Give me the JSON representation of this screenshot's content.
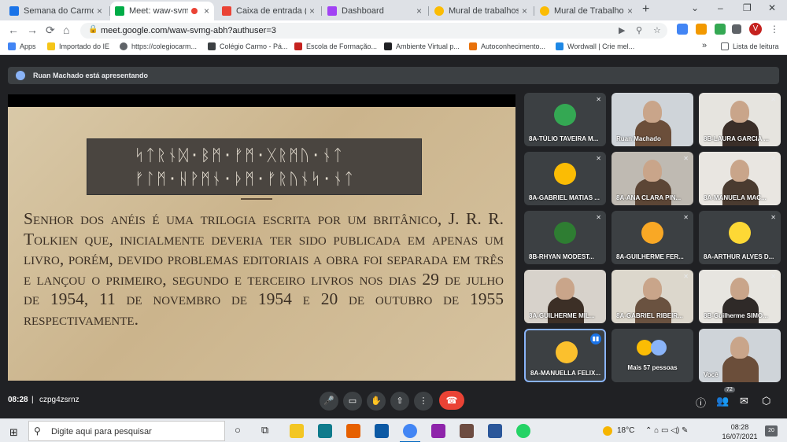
{
  "browser": {
    "tabs": [
      {
        "title": "Semana do Carmo - 8°",
        "favicon_color": "#1a73e8"
      },
      {
        "title": "Meet: waw-svmg-",
        "favicon_color": "#00ac47",
        "active": true,
        "recording": true
      },
      {
        "title": "Caixa de entrada (41)",
        "favicon_color": "#ea4335"
      },
      {
        "title": "Dashboard",
        "favicon_color": "#a142f4"
      },
      {
        "title": "Mural de trabalhos do",
        "favicon_color": "#fbbc04"
      },
      {
        "title": "Mural de Trabalhos do",
        "favicon_color": "#fbbc04"
      }
    ],
    "close_glyph": "×",
    "newtab_glyph": "+",
    "window_controls": {
      "profile": "⌄",
      "minimize": "–",
      "maximize": "❐",
      "close": "✕"
    },
    "nav": {
      "back": "←",
      "forward": "→",
      "reload": "⟳",
      "home": "⌂"
    },
    "url": "meet.google.com/waw-svmg-abh?authuser=3",
    "omnibox_icons": {
      "camera": "▶",
      "zoom": "⚲",
      "star": "☆"
    },
    "profile_initial": "V",
    "menu_glyph": "⋮",
    "extension_colors": [
      "#4285f4",
      "#f29900",
      "#34a853",
      "#5f6368",
      "#5f6368"
    ],
    "bookmarks": [
      {
        "label": "Apps",
        "color": "#4285f4"
      },
      {
        "label": "Importado do IE",
        "color": "#f5c518"
      },
      {
        "label": "https://colegiocarm...",
        "color": "#5f6368"
      },
      {
        "label": "Colégio Carmo - Pá...",
        "color": "#3c4043"
      },
      {
        "label": "Escola de Formação...",
        "color": "#c5221f"
      },
      {
        "label": "Ambiente Virtual p...",
        "color": "#202124"
      },
      {
        "label": "Autoconhecimento...",
        "color": "#e8710a"
      },
      {
        "label": "Wordwall | Crie mel...",
        "color": "#1e88e5"
      }
    ],
    "bookmarks_overflow": "»",
    "reading_list": "Lista de leitura"
  },
  "meet": {
    "presenter_label": "Ruan Machado está apresentando",
    "slide": {
      "runes_line1": "ᛋᛏᚱᚾᛞ·ᛒᛗ·ᚠᛗ·ᚷᚱᛗᚢ·ᚾᛏ",
      "runes_line2": "ᚠᛚᛗ·ᚺᚹᛗᚾ·ᚦᛗ·ᚠᚱᚢᚾᛋ·ᚾᛏ",
      "text": "Senhor dos anéis é uma trilogia escrita por um britânico, J. R. R. Tolkien que, inicialmente deveria ter sido publicada em apenas um livro, porém, devido problemas editoriais a obra foi separada em três e lançou o primeiro, segundo e terceiro livros nos dias 29 de julho de 1954, 11 de novembro de 1954 e 20 de outubro de 1955 respectivamente."
    },
    "mic_off_glyph": "✕",
    "speaking_glyph": "▮▮",
    "participants": [
      {
        "name": "8A-TÚLIO TAVEIRA M...",
        "kind": "avatar",
        "color": "#34a853",
        "muted": true
      },
      {
        "name": "Ruan Machado",
        "kind": "video",
        "muted": false
      },
      {
        "name": "8B-LAURA GARCIA ...",
        "kind": "video",
        "muted": true
      },
      {
        "name": "8A-GABRIEL MATIAS ...",
        "kind": "avatar",
        "color": "#fbbc04",
        "muted": true
      },
      {
        "name": "8A-ANA CLARA PIN...",
        "kind": "video",
        "muted": true
      },
      {
        "name": "8A-MANUELA MAC...",
        "kind": "video",
        "muted": true
      },
      {
        "name": "8B-RHYAN MODEST...",
        "kind": "avatar",
        "color": "#2e7d32",
        "muted": true
      },
      {
        "name": "8A-GUILHERME FER...",
        "kind": "avatar",
        "color": "#f9a825",
        "muted": true
      },
      {
        "name": "8A-ARTHUR ALVES D...",
        "kind": "avatar",
        "color": "#fdd835",
        "muted": true
      },
      {
        "name": "8A-GUILHERME MIL...",
        "kind": "video",
        "muted": false
      },
      {
        "name": "8A-GABRIEL RIBEIR...",
        "kind": "video",
        "muted": true
      },
      {
        "name": "8B-Guilherme SIMO...",
        "kind": "video",
        "muted": true
      },
      {
        "name": "8A-MANUELLA FELIX...",
        "kind": "avatar",
        "color": "#fbc02d",
        "muted": false,
        "speaking": true
      },
      {
        "name": "Mais 57 pessoas",
        "kind": "more",
        "muted": false
      },
      {
        "name": "Você",
        "kind": "video",
        "muted": false
      }
    ],
    "controls": {
      "time": "08:28",
      "separator": "|",
      "meeting_code": "czpg4zsrnz",
      "mic": "🎤",
      "camera": "▭",
      "hand": "✋",
      "present": "⇧",
      "more": "⋮",
      "end": "☎",
      "info": "ⓘ",
      "people": "👥",
      "people_count": "72",
      "chat": "✉",
      "activities": "⬡"
    }
  },
  "taskbar": {
    "windows_logo": "⊞",
    "search_glyph": "⚲",
    "search_placeholder": "Digite aqui para pesquisar",
    "cortana_glyph": "○",
    "taskview_glyph": "⧉",
    "app_colors": [
      "#f3c623",
      "#0f7b8c",
      "#e66000",
      "#0c59a4",
      "#4285f4",
      "#8e24aa",
      "#6d4c41",
      "#2b579a",
      "#25d366"
    ],
    "weather": "18°C",
    "tray_glyphs": "⌃ ⌂ ▭ ◁) ✎",
    "time": "08:28",
    "date": "16/07/2021",
    "notifications": "20"
  }
}
